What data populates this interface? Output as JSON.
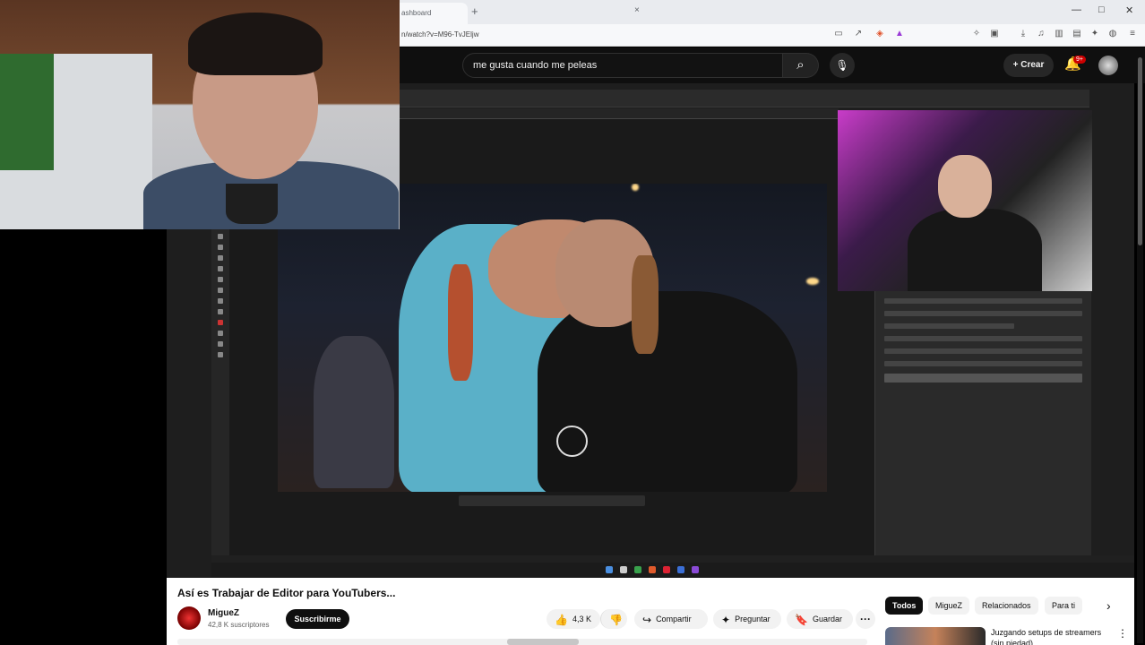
{
  "browser": {
    "tab_title": "ashboard",
    "url": "n/watch?v=M96-TvJEljw"
  },
  "youtube": {
    "search_value": "me gusta cuando me peleas",
    "create_label": "Crear",
    "notifications_badge": "9+",
    "icons": {
      "search": "search-icon",
      "mic": "mic-icon",
      "bell": "bell-icon"
    }
  },
  "video": {
    "title": "Así es Trabajar de Editor para YouTubers...",
    "progress_fraction": 0.53
  },
  "channel": {
    "name": "MigueZ",
    "subscribers": "42,8 K suscriptores",
    "subscribe_label": "Suscribirme"
  },
  "actions": {
    "likes": "4,3 K",
    "share_label": "Compartir",
    "ask_label": "Preguntar",
    "save_label": "Guardar"
  },
  "filters": {
    "chips": [
      "Todos",
      "MigueZ",
      "Relacionados",
      "Para ti"
    ],
    "active": "Todos"
  },
  "recommended": {
    "title": "Juzgando setups de streamers (sin piedad)"
  },
  "colors": {
    "accent_red": "#cc0000",
    "dark_bg": "#0f0f0f"
  }
}
